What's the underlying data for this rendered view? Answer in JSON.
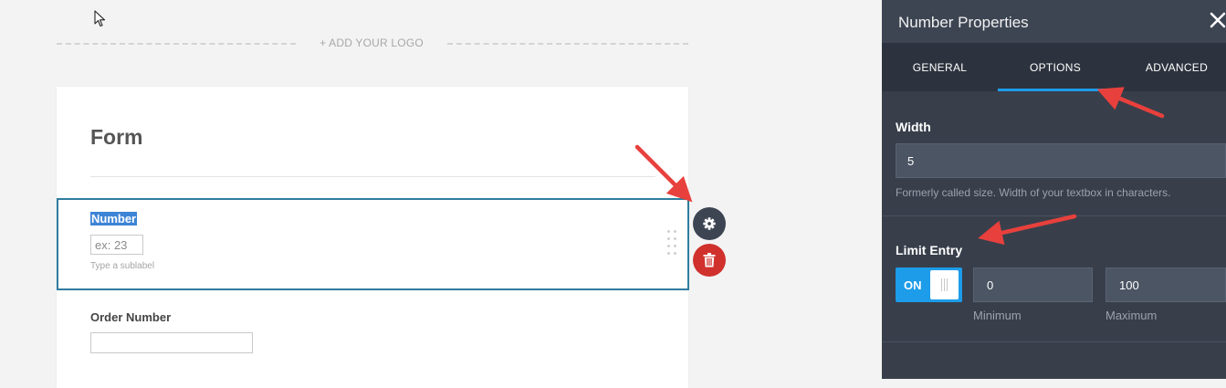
{
  "canvas": {
    "logo_prompt": "+ ADD YOUR LOGO",
    "form_title": "Form",
    "selected_field": {
      "label": "Number",
      "placeholder": "ex: 23",
      "sublabel": "Type a sublabel"
    },
    "order_field": {
      "label": "Order Number"
    },
    "actions": {
      "settings_icon": "gear-icon",
      "delete_icon": "trash-icon"
    }
  },
  "panel": {
    "title": "Number Properties",
    "close_icon": "close-icon",
    "tabs": [
      {
        "label": "GENERAL"
      },
      {
        "label": "OPTIONS",
        "active": true
      },
      {
        "label": "ADVANCED"
      }
    ],
    "width": {
      "label": "Width",
      "value": "5",
      "hint": "Formerly called size. Width of your textbox in characters."
    },
    "limit_entry": {
      "label": "Limit Entry",
      "toggle_state": "ON",
      "minimum_value": "0",
      "maximum_value": "100",
      "minimum_label": "Minimum",
      "maximum_label": "Maximum"
    }
  },
  "colors": {
    "accent_blue": "#1d9ce9",
    "panel_bg": "#383f4b",
    "delete_red": "#d0312d",
    "annotation_red": "#e8403c"
  }
}
